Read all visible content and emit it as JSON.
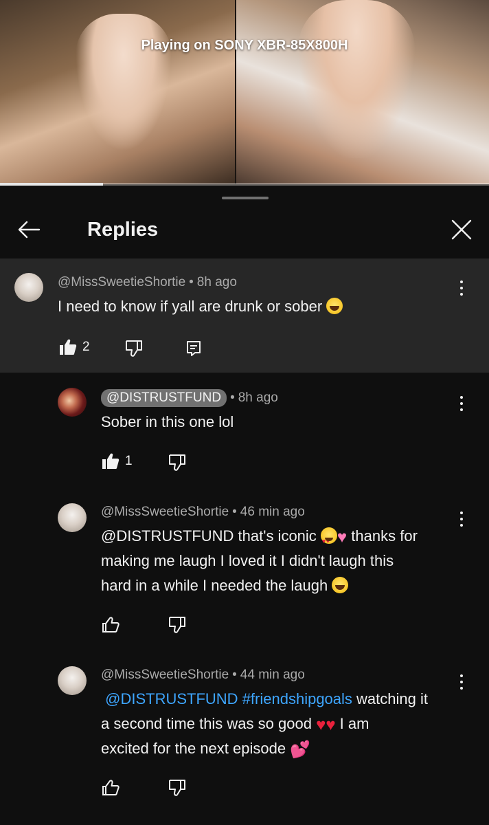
{
  "player": {
    "casting_text": "Playing on SONY XBR-85X800H",
    "progress": 0.21
  },
  "sheet": {
    "title": "Replies"
  },
  "parent_comment": {
    "author": "@MissSweetieShortie",
    "age": "8h ago",
    "text": "I need to know if yall are drunk or sober",
    "emoji": "grinning-squinting-face",
    "likes": "2"
  },
  "replies": [
    {
      "author": "@DISTRUSTFUND",
      "age": "8h ago",
      "is_creator": true,
      "text": "Sober in this one lol",
      "likes": "1"
    },
    {
      "author": "@MissSweetieShortie",
      "age": "46 min ago",
      "mention": "@DISTRUSTFUND",
      "text_part1": " that's iconic ",
      "text_part2": " thanks for",
      "line2": "making me laugh I loved it I didn't laugh this",
      "line3": "hard in a while I needed the laugh ",
      "likes": ""
    },
    {
      "author": "@MissSweetieShortie",
      "age": "44 min ago",
      "mention": "@DISTRUSTFUND",
      "hashtag": "#friendshipgoals",
      "text_part1": " watching it",
      "line2": "a second time this was so good ",
      "line2_tail": " I am",
      "line3": "excited for the next episode ",
      "likes": ""
    }
  ],
  "separator_dot": "•",
  "colors": {
    "background": "#0f0f0f",
    "highlight": "#272727",
    "meta_text": "#aaaaaa",
    "link": "#3ea6ff"
  }
}
